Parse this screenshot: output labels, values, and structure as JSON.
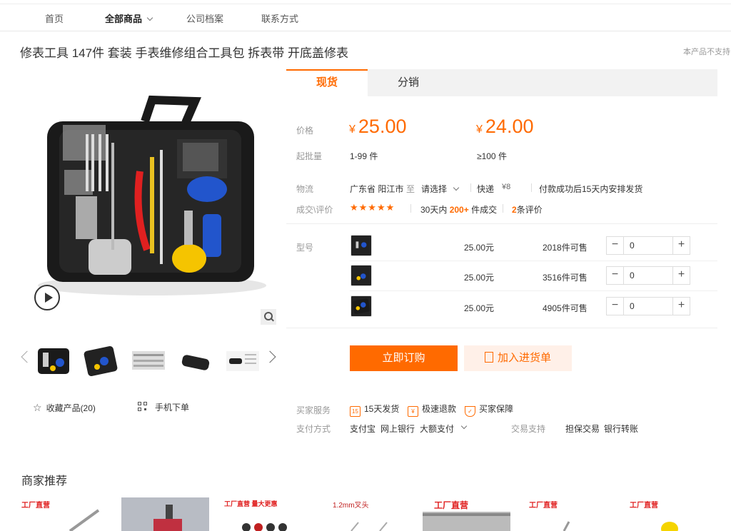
{
  "nav": {
    "items": [
      {
        "label": "首页"
      },
      {
        "label": "全部商品"
      },
      {
        "label": "公司档案"
      },
      {
        "label": "联系方式"
      }
    ]
  },
  "product": {
    "title": "修表工具 147件 套装 手表维修组合工具包 拆表带 开底盖修表",
    "title_note": "本产品不支持"
  },
  "tabs": [
    "现货",
    "分销"
  ],
  "pricing": {
    "price_label": "价格",
    "currency": "¥",
    "price1": "25.00",
    "price2": "24.00",
    "moq_label": "起批量",
    "range1": "1-99 件",
    "range2": "≥100 件"
  },
  "logistics": {
    "label": "物流",
    "from": "广东省 阳江市",
    "to_word": "至",
    "select": "请选择",
    "express": "快递",
    "fee": "¥8",
    "note": "付款成功后15天内安排发货"
  },
  "reviews": {
    "label": "成交\\评价",
    "stars": "★★★★★",
    "days": "30天内",
    "count": "200+",
    "count_suffix": "件成交",
    "review_count": "2",
    "review_suffix": "条评价"
  },
  "variants": {
    "label": "型号",
    "rows": [
      {
        "price": "25.00元",
        "stock": "2018件可售",
        "qty": "0"
      },
      {
        "price": "25.00元",
        "stock": "3516件可售",
        "qty": "0"
      },
      {
        "price": "25.00元",
        "stock": "4905件可售",
        "qty": "0"
      }
    ]
  },
  "actions": {
    "buy": "立即订购",
    "cart": "加入进货单"
  },
  "left": {
    "favorite": "收藏产品(20)",
    "mobile": "手机下单"
  },
  "services": {
    "label": "买家服务",
    "items": [
      "15天发货",
      "极速退款",
      "买家保障"
    ],
    "pay_label": "支付方式",
    "pay_methods": [
      "支付宝",
      "网上银行",
      "大额支付"
    ],
    "trade_label": "交易支持",
    "trade_methods": [
      "担保交易",
      "银行转账"
    ]
  },
  "recommend": {
    "title": "商家推荐",
    "tags": [
      "工厂直营",
      "",
      "工厂直营 量大更惠",
      "1.2mm叉头",
      "工厂直营",
      "工厂直营",
      "工厂直营"
    ]
  },
  "colors": {
    "accent": "#ff6a00"
  }
}
